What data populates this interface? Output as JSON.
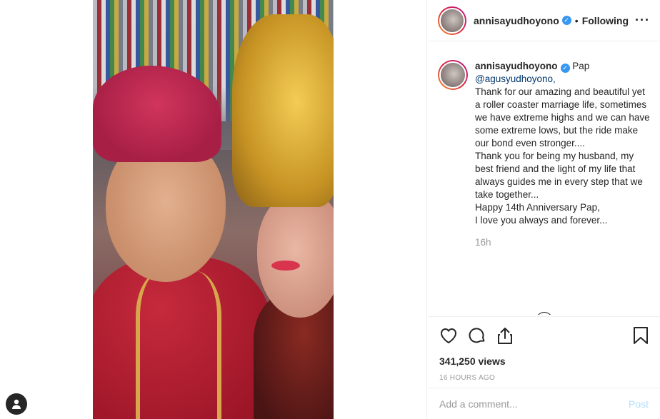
{
  "post": {
    "video_description": "Selfie of couple in traditional wedding attire"
  },
  "header": {
    "username": "annisayudhoyono",
    "verified_icon": "verified-badge-icon",
    "separator": "•",
    "follow_status": "Following",
    "more_label": "···"
  },
  "caption": {
    "username": "annisayudhoyono",
    "first_word": "Pap",
    "mention": "@agusyudhoyono,",
    "text": "Thank for our amazing and beautiful yet a roller coaster marriage life, sometimes we have extreme highs and we can have some extreme lows, but the ride make our bond even stronger....\nThank you for being my husband, my best friend and the light of my life that always guides me in every step that we take together...\nHappy 14th Anniversary Pap,\nI love you always and forever...",
    "time_ago": "16h"
  },
  "load_more_label": "+",
  "actions": {
    "like_icon": "heart-icon",
    "comment_icon": "comment-icon",
    "share_icon": "share-icon",
    "save_icon": "bookmark-icon"
  },
  "stats": {
    "views": "341,250 views",
    "posted": "16 HOURS AGO"
  },
  "comment_box": {
    "placeholder": "Add a comment...",
    "post_label": "Post"
  },
  "colors": {
    "verified": "#3897f0",
    "post_disabled": "#b2dffc",
    "muted": "#999999"
  }
}
